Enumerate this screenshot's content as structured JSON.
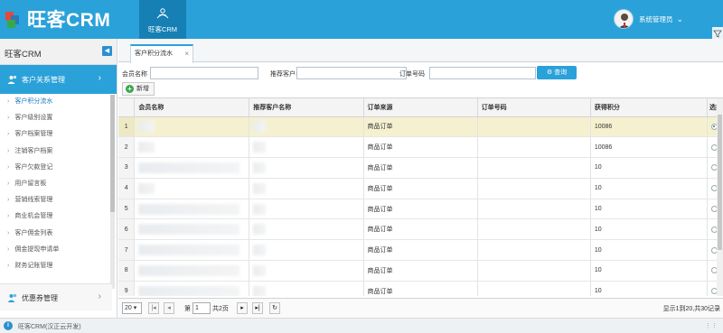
{
  "header": {
    "logo_text": "旺客CRM",
    "nav_tab_label": "旺客CRM",
    "user_name": "系统管理员",
    "brand_color": "#2aa1d9"
  },
  "sidebar": {
    "title": "旺客CRM",
    "group_label": "客户关系管理",
    "items": [
      {
        "label": "客户积分流水",
        "active": true
      },
      {
        "label": "客户级别设置"
      },
      {
        "label": "客户档案管理"
      },
      {
        "label": "注销客户档案"
      },
      {
        "label": "客户欠款登记"
      },
      {
        "label": "用户留言板"
      },
      {
        "label": "营销线索管理"
      },
      {
        "label": "商业机会管理"
      },
      {
        "label": "客户佣金列表"
      },
      {
        "label": "佣金提现申请单"
      },
      {
        "label": "财务记账管理"
      }
    ],
    "group2_label": "优惠券管理"
  },
  "main": {
    "tab_label": "客户积分流水",
    "filters": {
      "member_name_label": "会员名称",
      "referrer_label": "推荐客户名称",
      "order_no_label": "订单号码",
      "search_label": "查询"
    },
    "add_label": "新增",
    "columns": [
      "会员名称",
      "推荐客户名称",
      "订单来源",
      "订单号码",
      "获得积分",
      "选择"
    ],
    "rows": [
      {
        "num": "1",
        "source": "商品订单",
        "points": "10086",
        "selected": true
      },
      {
        "num": "2",
        "source": "商品订单",
        "points": "10086"
      },
      {
        "num": "3",
        "source": "商品订单",
        "points": "10"
      },
      {
        "num": "4",
        "source": "商品订单",
        "points": "10"
      },
      {
        "num": "5",
        "source": "商品订单",
        "points": "10"
      },
      {
        "num": "6",
        "source": "商品订单",
        "points": "10"
      },
      {
        "num": "7",
        "source": "商品订单",
        "points": "10"
      },
      {
        "num": "8",
        "source": "商品订单",
        "points": "10"
      },
      {
        "num": "9",
        "source": "商品订单",
        "points": "10"
      }
    ],
    "pager": {
      "page_size": "20",
      "page_prefix": "第",
      "page_value": "1",
      "page_suffix": "共2页",
      "info": "显示1到20,共30记录"
    }
  },
  "footer": {
    "text": "旺客CRM(汉正云开发)"
  }
}
